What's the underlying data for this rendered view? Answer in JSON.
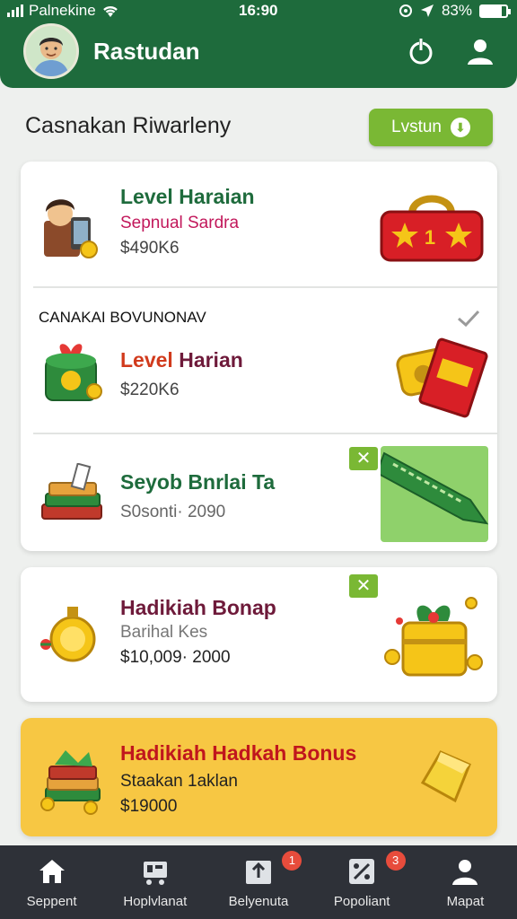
{
  "status_bar": {
    "carrier": "Palnekine",
    "time": "16:90",
    "battery": "83%",
    "battery_level": 0.83
  },
  "header": {
    "title": "Rastudan"
  },
  "section": {
    "title": "Casnakan Riwarleny",
    "button_label": "Lvstun"
  },
  "card1": {
    "row1": {
      "title": "Level Haraian",
      "subtitle": "Sepnual Sardra",
      "value": "$490K6"
    },
    "row2": {
      "heading": "CANAKAI BOVUNONAV",
      "title": "Level Harian",
      "value": "$220K6"
    },
    "row3": {
      "title": "Seyob Bnrlai Ta",
      "value": "S0sonti· 2090"
    }
  },
  "card2": {
    "title": "Hadikiah Bonap",
    "subtitle": "Barihal Kes",
    "value": "$10,009· 2000"
  },
  "card3": {
    "title": "Hadikiah Hadkah Bonus",
    "subtitle": "Staakan 1aklan",
    "value": "$19000"
  },
  "nav": [
    {
      "label": "Seppent"
    },
    {
      "label": "Hoplvlanat"
    },
    {
      "label": "Belyenuta",
      "badge": "1"
    },
    {
      "label": "Popoliant",
      "badge": "3"
    },
    {
      "label": "Mapat"
    }
  ],
  "colors": {
    "header": "#1e6b3c",
    "accent_green": "#7ab834",
    "title_green": "#1e6b3c",
    "title_red": "#d13a1c",
    "title_maroon": "#6e1a3a",
    "highlight_card": "#f7c743",
    "nav_bg": "#2e3138"
  }
}
